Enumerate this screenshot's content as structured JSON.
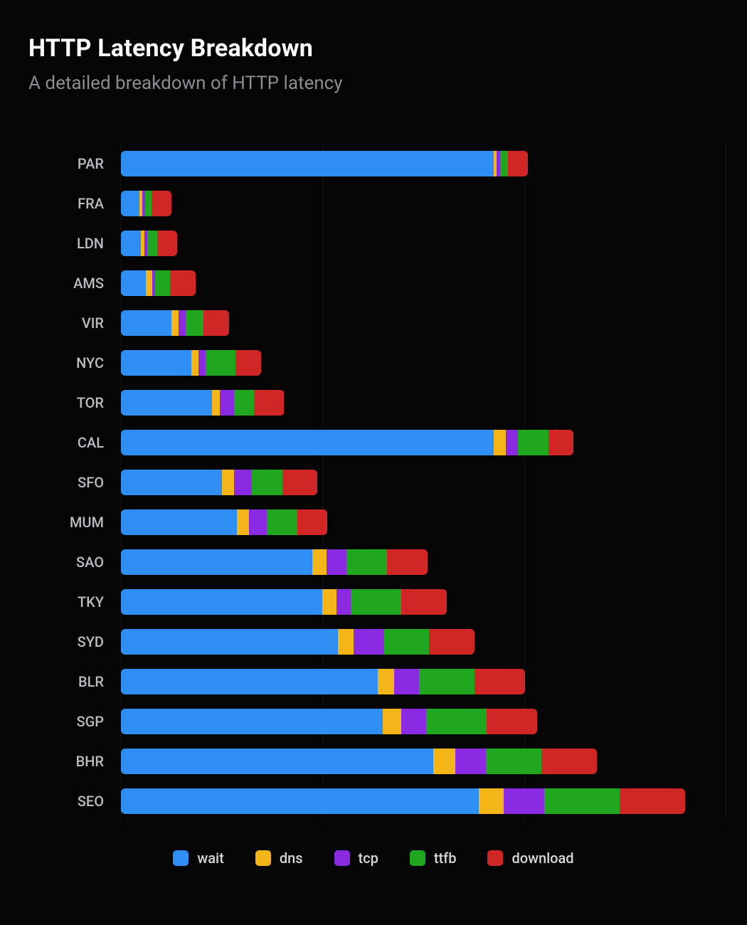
{
  "header": {
    "title": "HTTP Latency Breakdown",
    "subtitle": "A detailed breakdown of HTTP latency"
  },
  "legend": {
    "wait": "wait",
    "dns": "dns",
    "tcp": "tcp",
    "ttfb": "ttfb",
    "download": "download"
  },
  "colors": {
    "wait": "#2f8ef4",
    "dns": "#f3b518",
    "tcp": "#8a2be2",
    "ttfb": "#1fa81f",
    "download": "#d22626"
  },
  "chart_data": {
    "type": "bar",
    "orientation": "horizontal",
    "stacked": true,
    "title": "HTTP Latency Breakdown",
    "subtitle": "A detailed breakdown of HTTP latency",
    "xlabel": "",
    "ylabel": "",
    "xlim": [
      0,
      600
    ],
    "grid_x": [
      0,
      200,
      400,
      600
    ],
    "categories": [
      "PAR",
      "FRA",
      "LDN",
      "AMS",
      "VIR",
      "NYC",
      "TOR",
      "CAL",
      "SFO",
      "MUM",
      "SAO",
      "TKY",
      "SYD",
      "BLR",
      "SGP",
      "BHR",
      "SEO"
    ],
    "series": [
      {
        "name": "wait",
        "color": "#2f8ef4",
        "values": [
          370,
          18,
          20,
          25,
          50,
          70,
          90,
          370,
          100,
          115,
          190,
          200,
          215,
          255,
          260,
          310,
          355
        ]
      },
      {
        "name": "dns",
        "color": "#f3b518",
        "values": [
          3,
          3,
          3,
          6,
          7,
          7,
          8,
          12,
          12,
          12,
          14,
          14,
          16,
          16,
          18,
          22,
          25
        ]
      },
      {
        "name": "tcp",
        "color": "#8a2be2",
        "values": [
          3,
          3,
          3,
          3,
          7,
          7,
          14,
          12,
          18,
          18,
          20,
          14,
          30,
          25,
          25,
          30,
          40
        ]
      },
      {
        "name": "ttfb",
        "color": "#1fa81f",
        "values": [
          8,
          6,
          10,
          15,
          18,
          30,
          20,
          30,
          30,
          30,
          40,
          50,
          45,
          55,
          60,
          55,
          75
        ]
      },
      {
        "name": "download",
        "color": "#d22626",
        "values": [
          20,
          20,
          20,
          25,
          25,
          25,
          30,
          25,
          35,
          30,
          40,
          45,
          45,
          50,
          50,
          55,
          65
        ]
      }
    ]
  }
}
